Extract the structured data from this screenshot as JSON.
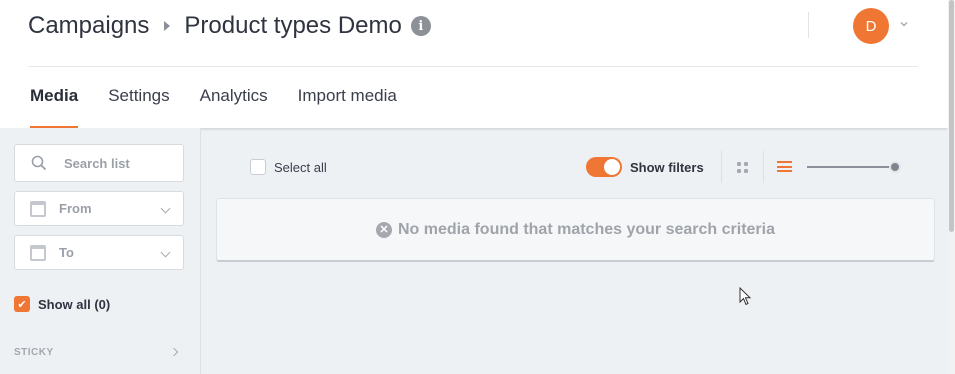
{
  "breadcrumb": {
    "root": "Campaigns",
    "current": "Product types Demo"
  },
  "user": {
    "initial": "D"
  },
  "tabs": [
    {
      "label": "Media",
      "active": true
    },
    {
      "label": "Settings",
      "active": false
    },
    {
      "label": "Analytics",
      "active": false
    },
    {
      "label": "Import media",
      "active": false
    }
  ],
  "sidebar": {
    "search_placeholder": "Search list",
    "from_label": "From",
    "to_label": "To",
    "show_all_label": "Show all (0)",
    "show_all_checked": true,
    "section_sticky": "STICKY"
  },
  "toolbar": {
    "select_all_label": "Select all",
    "show_filters_label": "Show filters",
    "show_filters_on": true,
    "view_mode": "list",
    "size_slider_level": 1.0
  },
  "empty_state": {
    "message": "No media found that matches your search criteria"
  },
  "colors": {
    "accent": "#ef7733",
    "text": "#2f3440",
    "muted": "#a0a4aa"
  }
}
